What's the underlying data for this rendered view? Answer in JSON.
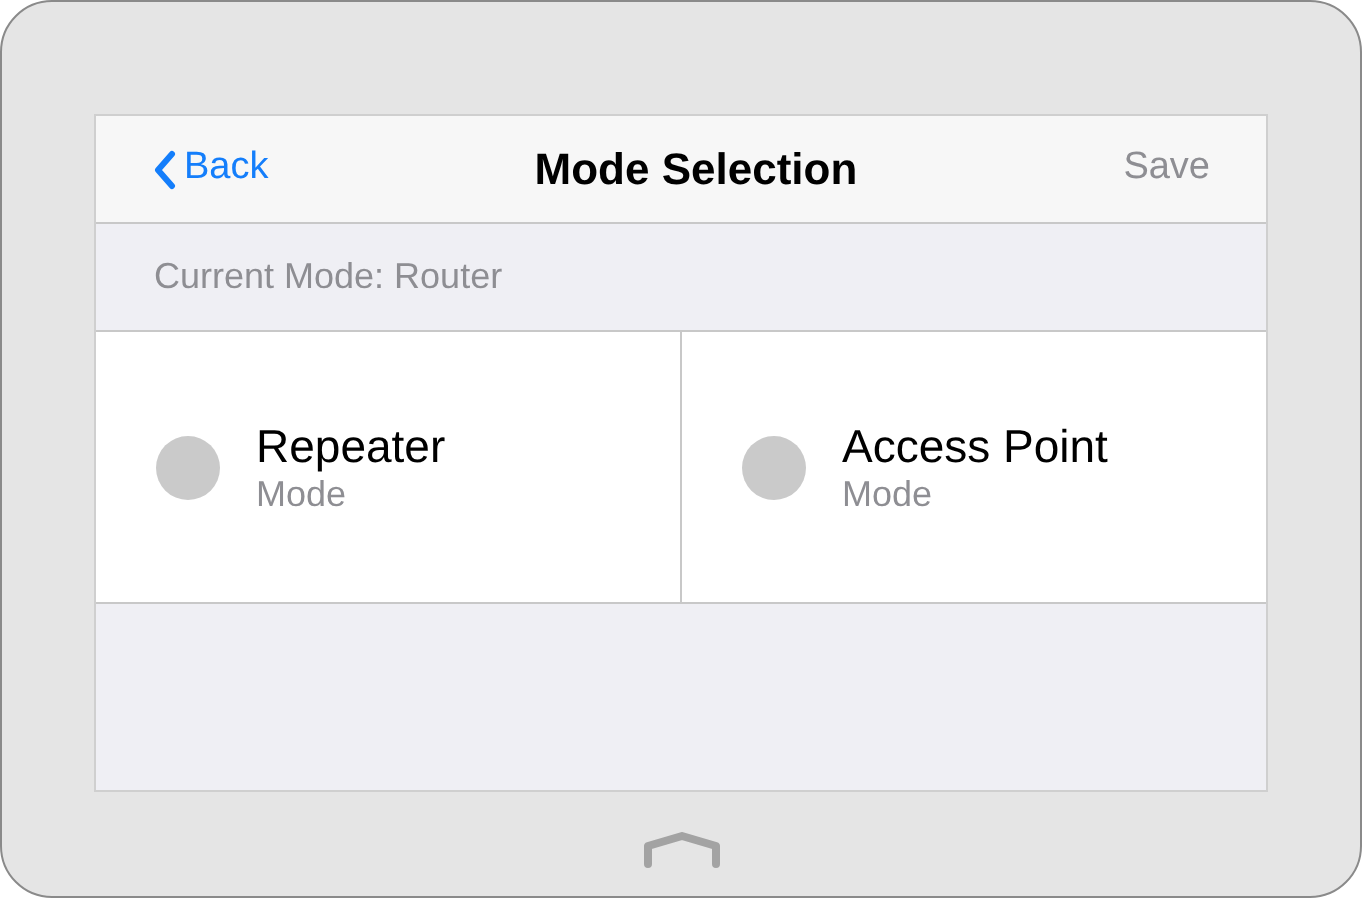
{
  "header": {
    "back": "Back",
    "title": "Mode Selection",
    "save": "Save"
  },
  "current_mode": "Current Mode: Router",
  "modes": [
    {
      "name": "Repeater",
      "subtitle": "Mode",
      "selected": false
    },
    {
      "name": "Access Point",
      "subtitle": "Mode",
      "selected": false
    }
  ]
}
